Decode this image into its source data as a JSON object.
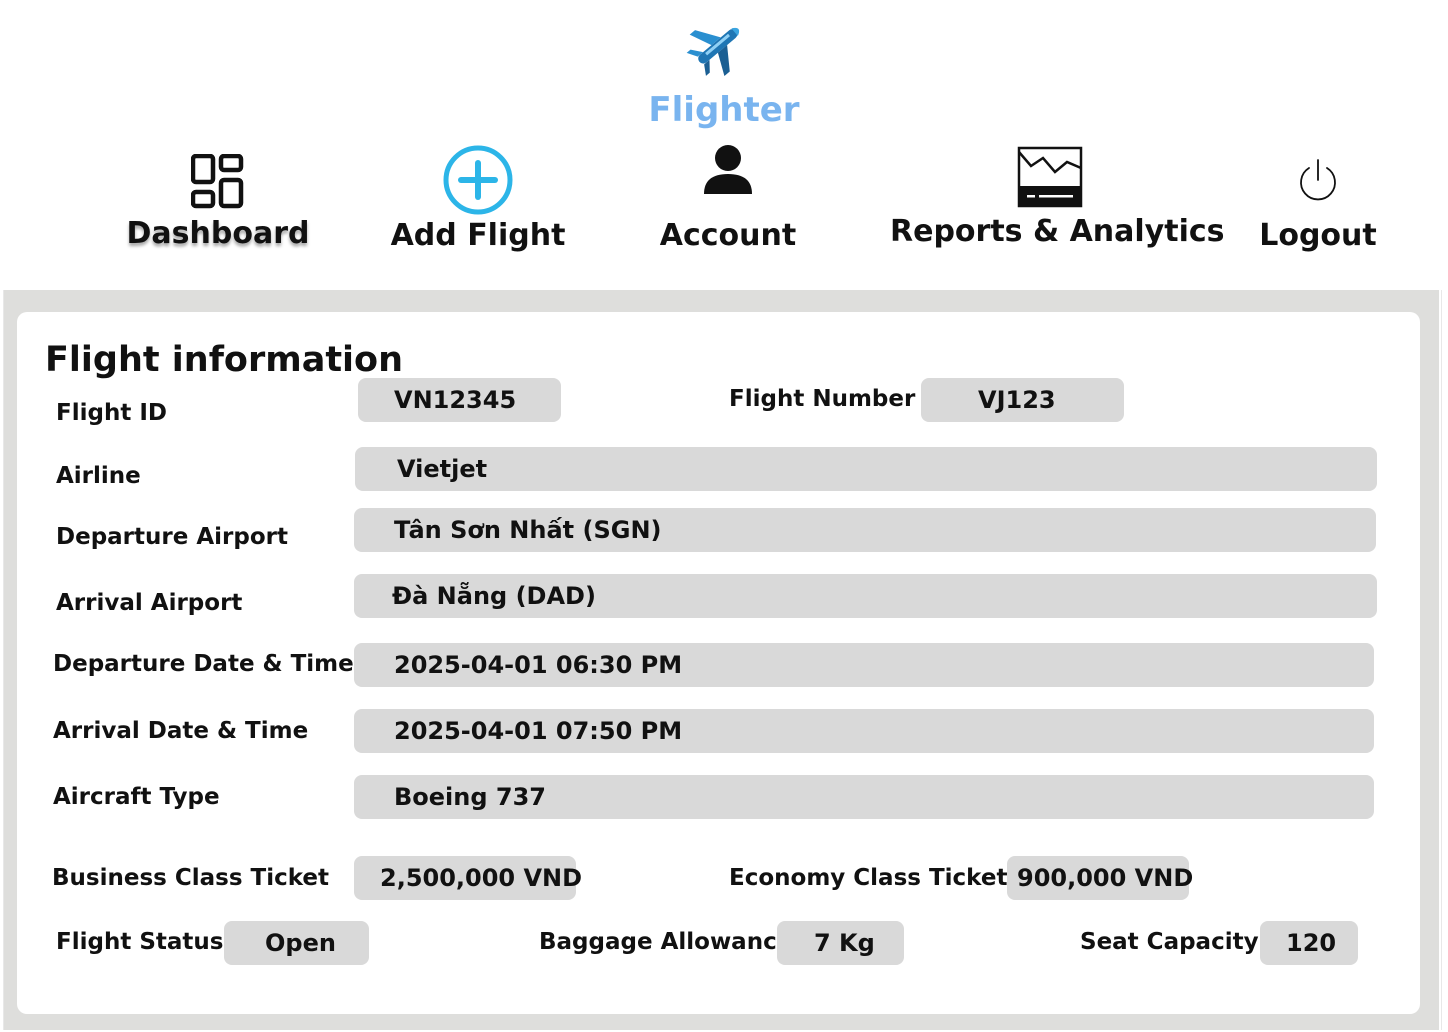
{
  "app": {
    "brand": "Flighter",
    "logo_icon": "airplane-icon"
  },
  "nav": {
    "dashboard": "Dashboard",
    "add_flight": "Add Flight",
    "account": "Account",
    "reports": "Reports & Analytics",
    "logout": "Logout"
  },
  "colors": {
    "brand": "#79b4ef",
    "add_icon": "#2cb5e8",
    "field_bg": "#d9d9d9",
    "content_bg": "#dededc"
  },
  "form": {
    "title": "Flight information",
    "fields": {
      "flight_id": {
        "label": "Flight ID",
        "value": "VN12345"
      },
      "flight_number": {
        "label": "Flight Number",
        "value": "VJ123"
      },
      "airline": {
        "label": "Airline",
        "value": "Vietjet"
      },
      "departure_airport": {
        "label": "Departure Airport",
        "value": "Tân Sơn Nhất (SGN)"
      },
      "arrival_airport": {
        "label": "Arrival Airport",
        "value": "Đà Nẵng (DAD)"
      },
      "departure_datetime": {
        "label": "Departure Date & Time",
        "value": "2025-04-01 06:30 PM"
      },
      "arrival_datetime": {
        "label": "Arrival Date & Time",
        "value": "2025-04-01 07:50 PM"
      },
      "aircraft_type": {
        "label": "Aircraft Type",
        "value": "Boeing 737"
      },
      "business_ticket": {
        "label": "Business Class Ticket",
        "value": "2,500,000 VND"
      },
      "economy_ticket": {
        "label": "Economy Class Ticket",
        "value": "900,000 VND"
      },
      "flight_status": {
        "label": "Flight Status",
        "value": "Open"
      },
      "baggage": {
        "label": "Baggage Allowance",
        "value": "7 Kg"
      },
      "seat_capacity": {
        "label": "Seat Capacity",
        "value": "120"
      }
    }
  }
}
